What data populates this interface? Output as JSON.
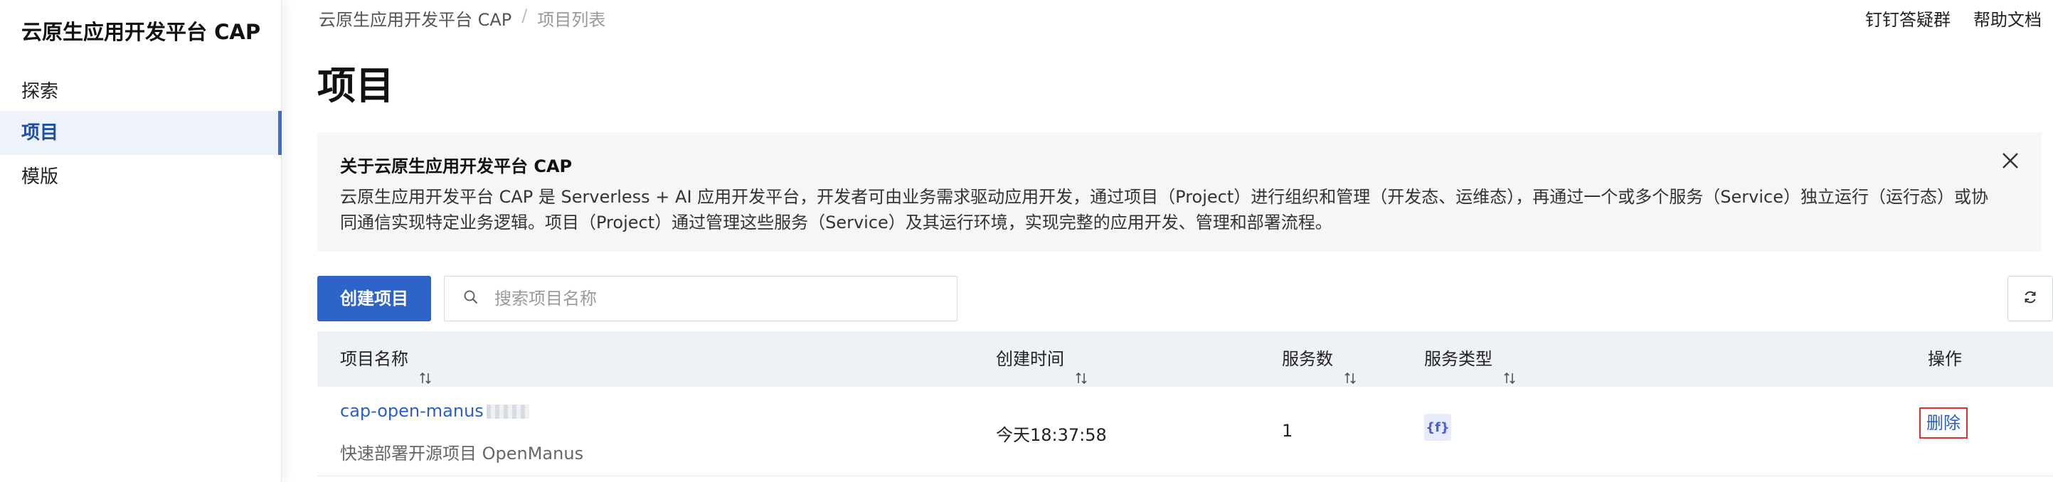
{
  "sidebar": {
    "brand": "云原生应用开发平台 CAP",
    "items": [
      {
        "label": "探索"
      },
      {
        "label": "项目"
      },
      {
        "label": "模版"
      }
    ]
  },
  "breadcrumb": {
    "root": "云原生应用开发平台 CAP",
    "separator": "/",
    "current": "项目列表"
  },
  "top_links": {
    "dingtalk": "钉钉答疑群",
    "help": "帮助文档"
  },
  "page": {
    "title": "项目"
  },
  "notice": {
    "title": "关于云原生应用开发平台 CAP",
    "body": "云原生应用开发平台 CAP 是 Serverless + AI 应用开发平台，开发者可由业务需求驱动应用开发，通过项目（Project）进行组织和管理（开发态、运维态），再通过一个或多个服务（Service）独立运行（运行态）或协同通信实现特定业务逻辑。项目（Project）通过管理这些服务（Service）及其运行环境，实现完整的应用开发、管理和部署流程。"
  },
  "toolbar": {
    "create_label": "创建项目",
    "search_placeholder": "搜索项目名称",
    "search_value": ""
  },
  "table": {
    "columns": [
      {
        "label": "项目名称"
      },
      {
        "label": "创建时间"
      },
      {
        "label": "服务数"
      },
      {
        "label": "服务类型"
      },
      {
        "label": "操作"
      }
    ],
    "rows": [
      {
        "name": "cap-open-manus",
        "description": "快速部署开源项目 OpenManus",
        "created": "今天18:37:58",
        "service_count": "1",
        "service_type_icon": "function-icon",
        "service_type_glyph": "{f}",
        "action": "删除"
      }
    ]
  },
  "colors": {
    "primary": "#2e64c8",
    "link": "#2a5fc6",
    "active_nav_bg": "#eef2f9",
    "highlight_border": "#e0312f"
  }
}
